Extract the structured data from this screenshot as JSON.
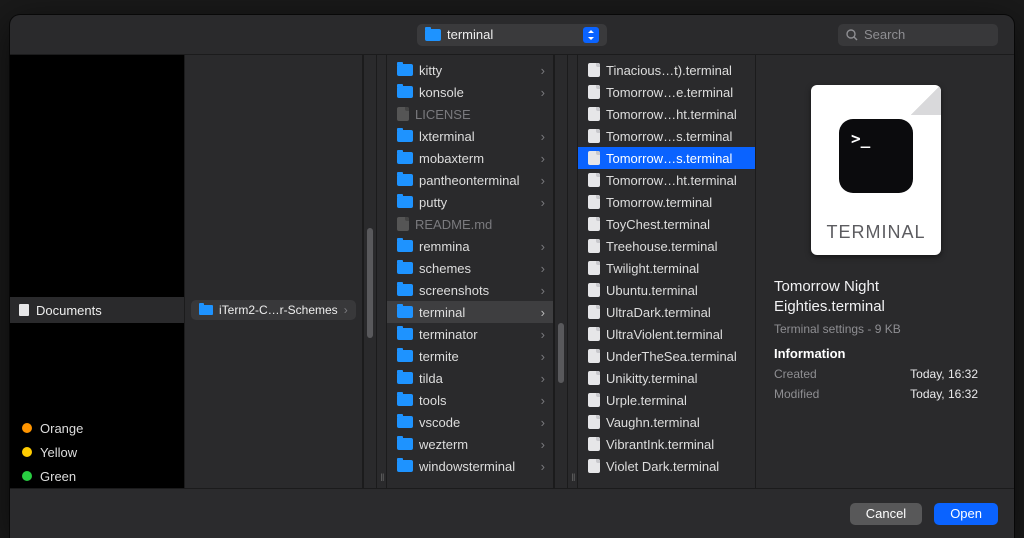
{
  "topbar": {
    "location": "terminal",
    "search_placeholder": "Search"
  },
  "sidebar": {
    "documents_label": "Documents",
    "tags": [
      {
        "label": "Orange",
        "color": "#ff9500"
      },
      {
        "label": "Yellow",
        "color": "#ffcc00"
      },
      {
        "label": "Green",
        "color": "#28cd41"
      }
    ]
  },
  "path": {
    "chip_label": "iTerm2-C…r-Schemes"
  },
  "folders": [
    {
      "label": "kitty",
      "type": "folder"
    },
    {
      "label": "konsole",
      "type": "folder"
    },
    {
      "label": "LICENSE",
      "type": "file",
      "dimmed": true
    },
    {
      "label": "lxterminal",
      "type": "folder"
    },
    {
      "label": "mobaxterm",
      "type": "folder"
    },
    {
      "label": "pantheonterminal",
      "type": "folder"
    },
    {
      "label": "putty",
      "type": "folder"
    },
    {
      "label": "README.md",
      "type": "file",
      "dimmed": true
    },
    {
      "label": "remmina",
      "type": "folder"
    },
    {
      "label": "schemes",
      "type": "folder"
    },
    {
      "label": "screenshots",
      "type": "folder"
    },
    {
      "label": "terminal",
      "type": "folder",
      "selected": true
    },
    {
      "label": "terminator",
      "type": "folder"
    },
    {
      "label": "termite",
      "type": "folder"
    },
    {
      "label": "tilda",
      "type": "folder"
    },
    {
      "label": "tools",
      "type": "folder"
    },
    {
      "label": "vscode",
      "type": "folder"
    },
    {
      "label": "wezterm",
      "type": "folder"
    },
    {
      "label": "windowsterminal",
      "type": "folder"
    }
  ],
  "files": [
    {
      "label": "Tinacious…t).terminal"
    },
    {
      "label": "Tomorrow…e.terminal"
    },
    {
      "label": "Tomorrow…ht.terminal"
    },
    {
      "label": "Tomorrow…s.terminal"
    },
    {
      "label": "Tomorrow…s.terminal",
      "selected": true
    },
    {
      "label": "Tomorrow…ht.terminal"
    },
    {
      "label": "Tomorrow.terminal"
    },
    {
      "label": "ToyChest.terminal"
    },
    {
      "label": "Treehouse.terminal"
    },
    {
      "label": "Twilight.terminal"
    },
    {
      "label": "Ubuntu.terminal"
    },
    {
      "label": "UltraDark.terminal"
    },
    {
      "label": "UltraViolent.terminal"
    },
    {
      "label": "UnderTheSea.terminal"
    },
    {
      "label": "Unikitty.terminal"
    },
    {
      "label": "Urple.terminal"
    },
    {
      "label": "Vaughn.terminal"
    },
    {
      "label": "VibrantInk.terminal"
    },
    {
      "label": "Violet Dark.terminal"
    }
  ],
  "preview": {
    "kind_label": "TERMINAL",
    "title": "Tomorrow Night Eighties.terminal",
    "subtitle": "Terminal settings - 9 KB",
    "section": "Information",
    "created_key": "Created",
    "created_val": "Today, 16:32",
    "modified_key": "Modified",
    "modified_val": "Today, 16:32"
  },
  "buttons": {
    "cancel": "Cancel",
    "open": "Open"
  }
}
